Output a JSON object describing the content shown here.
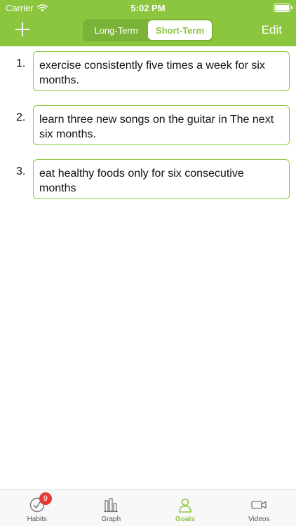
{
  "status_bar": {
    "carrier": "Carrier",
    "time": "5:02 PM",
    "wifi_icon": "wifi-icon",
    "battery_icon": "battery-icon"
  },
  "nav": {
    "plus_icon": "plus-icon",
    "segments": [
      {
        "label": "Long-Term",
        "active": false
      },
      {
        "label": "Short-Term",
        "active": true
      }
    ],
    "edit_label": "Edit"
  },
  "goals": [
    {
      "number": "1.",
      "text": "exercise consistently five times a week for six months."
    },
    {
      "number": "2.",
      "text": "learn three new songs on the guitar in The next six months."
    },
    {
      "number": "3.",
      "text": "eat healthy foods only for six consecutive months"
    }
  ],
  "tabbar": {
    "tabs": [
      {
        "label": "Habits",
        "icon": "check-circle-icon",
        "badge": "9",
        "active": false
      },
      {
        "label": "Graph",
        "icon": "bar-chart-icon",
        "active": false
      },
      {
        "label": "Goals",
        "icon": "person-icon",
        "active": true
      },
      {
        "label": "Videos",
        "icon": "video-camera-icon",
        "active": false
      }
    ]
  },
  "colors": {
    "accent": "#8cc63f",
    "badge": "#e53935"
  }
}
